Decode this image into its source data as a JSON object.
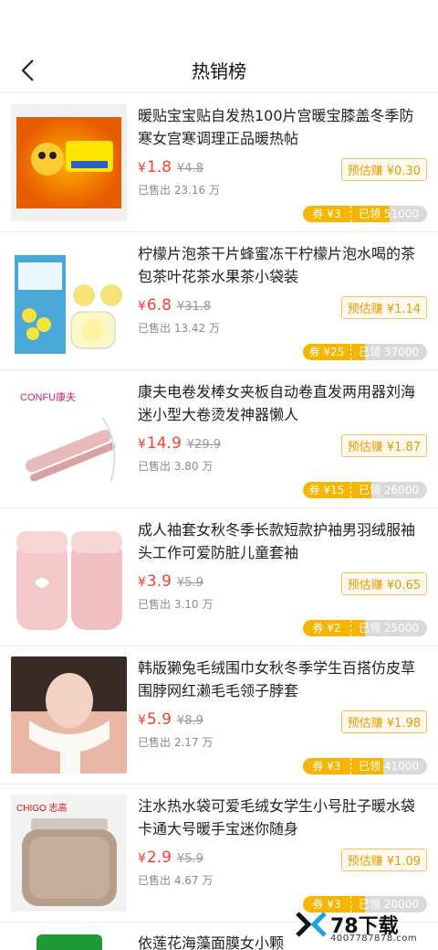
{
  "header": {
    "title": "热销榜"
  },
  "colors": {
    "price": "#ff3d2e",
    "accent": "#f7b500",
    "earn_border": "#f4c158"
  },
  "products": [
    {
      "title": "暖贴宝宝贴自发热100片宫暖宝膝盖冬季防寒女宫寒调理正品暖热帖",
      "currency": "¥",
      "price": "1.8",
      "old_price": "¥4.8",
      "earn": "预估赚 ¥0.30",
      "sold": "已售出 23.16 万",
      "coupon": "券 ¥3",
      "claimed": "已领 51000",
      "claimed_ratio": 0.7
    },
    {
      "title": "柠檬片泡茶干片蜂蜜冻干柠檬片泡水喝的茶包茶叶花茶水果茶小袋装",
      "currency": "¥",
      "price": "6.8",
      "old_price": "¥31.8",
      "earn": "预估赚 ¥1.14",
      "sold": "已售出 13.42 万",
      "coupon": "券 ¥25",
      "claimed": "已领 37000",
      "claimed_ratio": 0.5
    },
    {
      "title": "康夫电卷发棒女夹板自动卷直发两用器刘海迷小型大卷烫发神器懒人",
      "currency": "¥",
      "price": "14.9",
      "old_price": "¥29.9",
      "earn": "预估赚 ¥1.87",
      "sold": "已售出 3.80 万",
      "coupon": "券 ¥15",
      "claimed": "已领 26000",
      "claimed_ratio": 0.55
    },
    {
      "title": "成人袖套女秋冬季长款短款护袖男羽绒服袖头工作可爱防脏儿童套袖",
      "currency": "¥",
      "price": "3.9",
      "old_price": "¥5.9",
      "earn": "预估赚 ¥0.65",
      "sold": "已售出 3.10 万",
      "coupon": "券 ¥2",
      "claimed": "已领 25000",
      "claimed_ratio": 0.5
    },
    {
      "title": "韩版獭兔毛绒围巾女秋冬季学生百搭仿皮草围脖网红濑毛毛领子脖套",
      "currency": "¥",
      "price": "5.9",
      "old_price": "¥8.9",
      "earn": "预估赚 ¥1.98",
      "sold": "已售出 2.17 万",
      "coupon": "券 ¥3",
      "claimed": "已领 41000",
      "claimed_ratio": 0.65
    },
    {
      "title": "注水热水袋可爱毛绒女学生小号肚子暖水袋卡通大号暖手宝迷你随身",
      "currency": "¥",
      "price": "2.9",
      "old_price": "¥5.9",
      "earn": "预估赚 ¥1.09",
      "sold": "已售出 4.67 万",
      "coupon": "券 ¥3",
      "claimed": "已领 20000",
      "claimed_ratio": 0.5
    }
  ],
  "partial": {
    "title": "依莲花海藻面膜女小颗"
  },
  "watermark": {
    "name": "78下载",
    "phone": "4007787878.com"
  }
}
